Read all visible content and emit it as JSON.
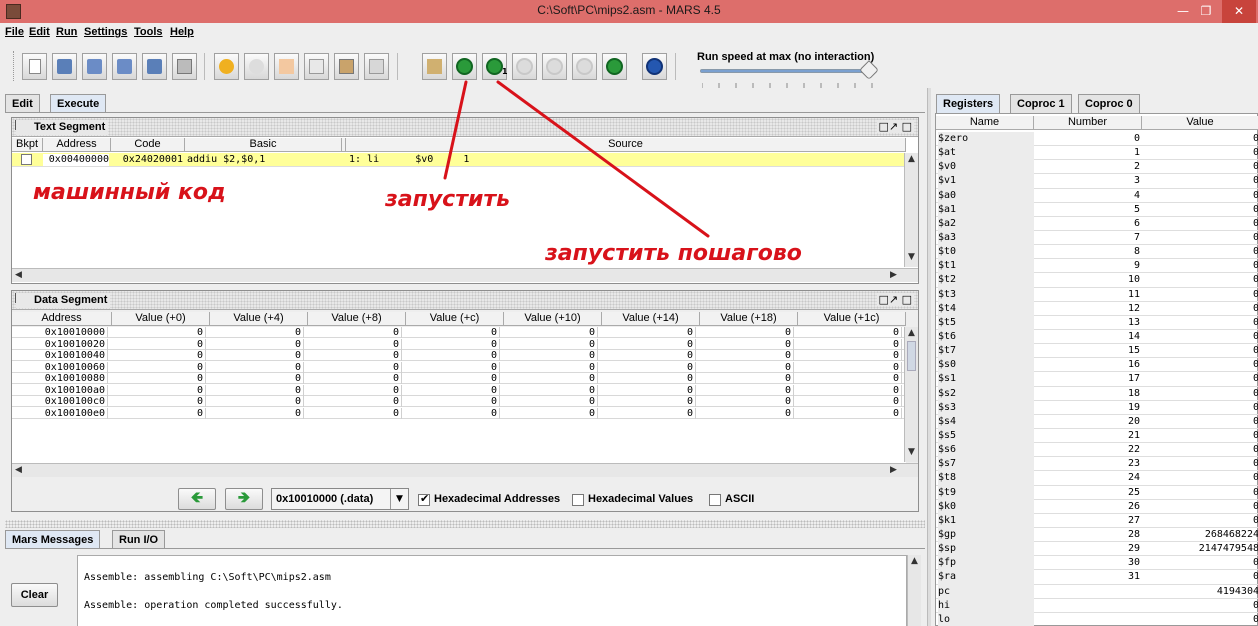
{
  "window": {
    "title": "C:\\Soft\\PC\\mips2.asm  - MARS 4.5"
  },
  "menu": [
    "File",
    "Edit",
    "Run",
    "Settings",
    "Tools",
    "Help"
  ],
  "toolbar": {
    "speed_label": "Run speed at max (no interaction)",
    "speed_fraction": 1.0
  },
  "main_tabs": [
    "Edit",
    "Execute"
  ],
  "text_segment": {
    "title": "Text Segment",
    "headers": [
      "Bkpt",
      "Address",
      "Code",
      "Basic",
      "",
      "Source"
    ],
    "rows": [
      {
        "address": "0x00400000",
        "code": "0x24020001",
        "basic": "addiu $2,$0,1",
        "source": "1: li      $v0     1"
      }
    ]
  },
  "annotations": {
    "machine_code": "машинный код",
    "run": "запустить",
    "run_step": "запустить пошагово"
  },
  "data_segment": {
    "title": "Data Segment",
    "headers": [
      "Address",
      "Value (+0)",
      "Value (+4)",
      "Value (+8)",
      "Value (+c)",
      "Value (+10)",
      "Value (+14)",
      "Value (+18)",
      "Value (+1c)"
    ],
    "rows": [
      [
        "0x10010000",
        "0",
        "0",
        "0",
        "0",
        "0",
        "0",
        "0",
        "0"
      ],
      [
        "0x10010020",
        "0",
        "0",
        "0",
        "0",
        "0",
        "0",
        "0",
        "0"
      ],
      [
        "0x10010040",
        "0",
        "0",
        "0",
        "0",
        "0",
        "0",
        "0",
        "0"
      ],
      [
        "0x10010060",
        "0",
        "0",
        "0",
        "0",
        "0",
        "0",
        "0",
        "0"
      ],
      [
        "0x10010080",
        "0",
        "0",
        "0",
        "0",
        "0",
        "0",
        "0",
        "0"
      ],
      [
        "0x100100a0",
        "0",
        "0",
        "0",
        "0",
        "0",
        "0",
        "0",
        "0"
      ],
      [
        "0x100100c0",
        "0",
        "0",
        "0",
        "0",
        "0",
        "0",
        "0",
        "0"
      ],
      [
        "0x100100e0",
        "0",
        "0",
        "0",
        "0",
        "0",
        "0",
        "0",
        "0"
      ]
    ],
    "address_select": "0x10010000 (.data)",
    "hex_addresses_label": "Hexadecimal Addresses",
    "hex_values_label": "Hexadecimal Values",
    "ascii_label": "ASCII"
  },
  "messages": {
    "tabs": [
      "Mars Messages",
      "Run I/O"
    ],
    "clear_label": "Clear",
    "lines": [
      "Assemble: assembling C:\\Soft\\PC\\mips2.asm",
      "Assemble: operation completed successfully."
    ]
  },
  "registers": {
    "tabs": [
      "Registers",
      "Coproc 1",
      "Coproc 0"
    ],
    "headers": [
      "Name",
      "Number",
      "Value"
    ],
    "rows": [
      [
        "$zero",
        "0",
        "0"
      ],
      [
        "$at",
        "1",
        "0"
      ],
      [
        "$v0",
        "2",
        "0"
      ],
      [
        "$v1",
        "3",
        "0"
      ],
      [
        "$a0",
        "4",
        "0"
      ],
      [
        "$a1",
        "5",
        "0"
      ],
      [
        "$a2",
        "6",
        "0"
      ],
      [
        "$a3",
        "7",
        "0"
      ],
      [
        "$t0",
        "8",
        "0"
      ],
      [
        "$t1",
        "9",
        "0"
      ],
      [
        "$t2",
        "10",
        "0"
      ],
      [
        "$t3",
        "11",
        "0"
      ],
      [
        "$t4",
        "12",
        "0"
      ],
      [
        "$t5",
        "13",
        "0"
      ],
      [
        "$t6",
        "14",
        "0"
      ],
      [
        "$t7",
        "15",
        "0"
      ],
      [
        "$s0",
        "16",
        "0"
      ],
      [
        "$s1",
        "17",
        "0"
      ],
      [
        "$s2",
        "18",
        "0"
      ],
      [
        "$s3",
        "19",
        "0"
      ],
      [
        "$s4",
        "20",
        "0"
      ],
      [
        "$s5",
        "21",
        "0"
      ],
      [
        "$s6",
        "22",
        "0"
      ],
      [
        "$s7",
        "23",
        "0"
      ],
      [
        "$t8",
        "24",
        "0"
      ],
      [
        "$t9",
        "25",
        "0"
      ],
      [
        "$k0",
        "26",
        "0"
      ],
      [
        "$k1",
        "27",
        "0"
      ],
      [
        "$gp",
        "28",
        "268468224"
      ],
      [
        "$sp",
        "29",
        "2147479548"
      ],
      [
        "$fp",
        "30",
        "0"
      ],
      [
        "$ra",
        "31",
        "0"
      ],
      [
        "pc",
        "",
        "4194304"
      ],
      [
        "hi",
        "",
        "0"
      ],
      [
        "lo",
        "",
        "0"
      ]
    ]
  },
  "colors": {
    "title_bar": "#dd6e6b",
    "annotation": "#d8121a",
    "highlight_row": "#ffff99"
  }
}
